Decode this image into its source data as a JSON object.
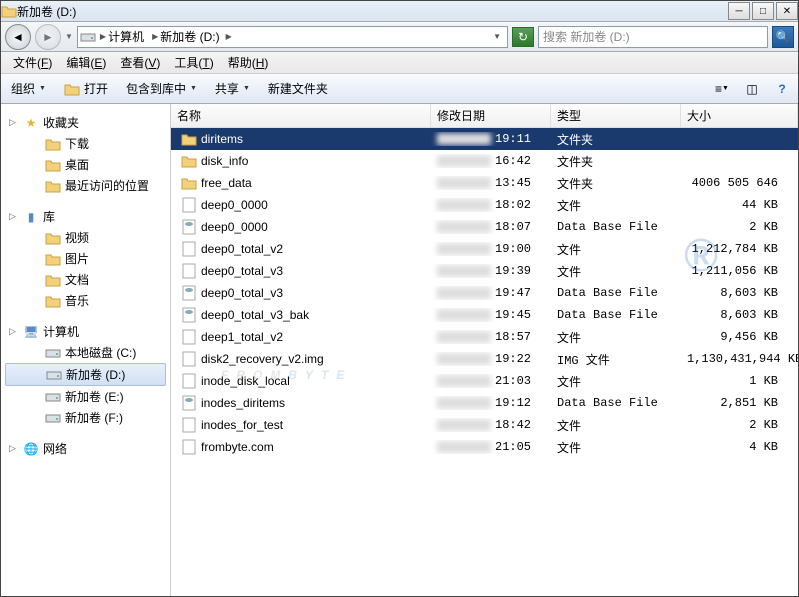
{
  "window": {
    "title": "新加卷 (D:)"
  },
  "nav": {
    "breadcrumb": [
      "计算机",
      "新加卷 (D:)"
    ],
    "search_placeholder": "搜索 新加卷 (D:)"
  },
  "menu": [
    {
      "l": "文件",
      "k": "F"
    },
    {
      "l": "编辑",
      "k": "E"
    },
    {
      "l": "查看",
      "k": "V"
    },
    {
      "l": "工具",
      "k": "T"
    },
    {
      "l": "帮助",
      "k": "H"
    }
  ],
  "toolbar": {
    "organize": "组织",
    "open": "打开",
    "include": "包含到库中",
    "share": "共享",
    "newfolder": "新建文件夹"
  },
  "sidebar": {
    "fav": {
      "label": "收藏夹",
      "items": [
        "下载",
        "桌面",
        "最近访问的位置"
      ]
    },
    "lib": {
      "label": "库",
      "items": [
        "视频",
        "图片",
        "文档",
        "音乐"
      ]
    },
    "comp": {
      "label": "计算机",
      "items": [
        "本地磁盘 (C:)",
        "新加卷 (D:)",
        "新加卷 (E:)",
        "新加卷 (F:)"
      ],
      "selected": 1
    },
    "net": {
      "label": "网络"
    }
  },
  "columns": {
    "name": "名称",
    "date": "修改日期",
    "type": "类型",
    "size": "大小"
  },
  "files": [
    {
      "name": "diritems",
      "time": "19:11",
      "type": "文件夹",
      "size": "",
      "icon": "folder",
      "sel": true
    },
    {
      "name": "disk_info",
      "time": "16:42",
      "type": "文件夹",
      "size": "",
      "icon": "folder"
    },
    {
      "name": "free_data",
      "time": "13:45",
      "type": "文件夹",
      "size": "4006 505 646",
      "icon": "folder"
    },
    {
      "name": "deep0_0000",
      "time": "18:02",
      "type": "文件",
      "size": "44 KB",
      "icon": "file"
    },
    {
      "name": "deep0_0000",
      "time": "18:07",
      "type": "Data Base File",
      "size": "2 KB",
      "icon": "db"
    },
    {
      "name": "deep0_total_v2",
      "time": "19:00",
      "type": "文件",
      "size": "1,212,784 KB",
      "icon": "file"
    },
    {
      "name": "deep0_total_v3",
      "time": "19:39",
      "type": "文件",
      "size": "1,211,056 KB",
      "icon": "file"
    },
    {
      "name": "deep0_total_v3",
      "time": "19:47",
      "type": "Data Base File",
      "size": "8,603 KB",
      "icon": "db"
    },
    {
      "name": "deep0_total_v3_bak",
      "time": "19:45",
      "type": "Data Base File",
      "size": "8,603 KB",
      "icon": "db"
    },
    {
      "name": "deep1_total_v2",
      "time": "18:57",
      "type": "文件",
      "size": "9,456 KB",
      "icon": "file"
    },
    {
      "name": "disk2_recovery_v2.img",
      "time": "19:22",
      "type": "IMG 文件",
      "size": "1,130,431,944 KB",
      "icon": "file"
    },
    {
      "name": "inode_disk_local",
      "time": "21:03",
      "type": "文件",
      "size": "1 KB",
      "icon": "file"
    },
    {
      "name": "inodes_diritems",
      "time": "19:12",
      "type": "Data Base File",
      "size": "2,851 KB",
      "icon": "db"
    },
    {
      "name": "inodes_for_test",
      "time": "18:42",
      "type": "文件",
      "size": "2 KB",
      "icon": "file"
    },
    {
      "name": "frombyte.com",
      "time": "21:05",
      "type": "文件",
      "size": "4 KB",
      "icon": "file"
    }
  ]
}
